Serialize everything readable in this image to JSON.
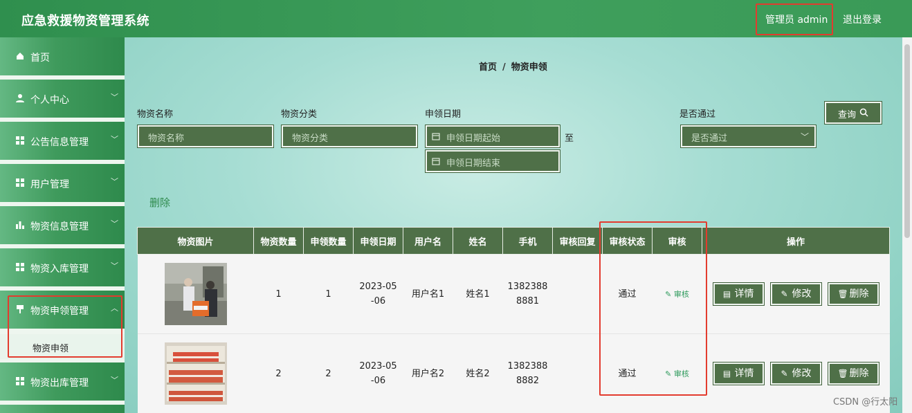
{
  "header": {
    "title": "应急救援物资管理系统",
    "admin_label": "管理员 admin",
    "logout_label": "退出登录"
  },
  "sidebar": {
    "items": [
      {
        "label": "首页",
        "icon": "home-icon"
      },
      {
        "label": "个人中心",
        "icon": "user-icon"
      },
      {
        "label": "公告信息管理",
        "icon": "grid-icon"
      },
      {
        "label": "用户管理",
        "icon": "grid-icon"
      },
      {
        "label": "物资信息管理",
        "icon": "bar-chart-icon"
      },
      {
        "label": "物资入库管理",
        "icon": "grid-icon"
      },
      {
        "label": "物资申领管理",
        "icon": "pin-icon"
      },
      {
        "label": "物资出库管理",
        "icon": "grid-icon"
      }
    ],
    "submenu_label": "物资申领"
  },
  "breadcrumb": {
    "home": "首页",
    "separator": "/",
    "current": "物资申领"
  },
  "filters": {
    "name_label": "物资名称",
    "name_placeholder": "物资名称",
    "category_label": "物资分类",
    "category_placeholder": "物资分类",
    "date_label": "申领日期",
    "date_start_placeholder": "申领日期起始",
    "date_end_placeholder": "申领日期结束",
    "to": "至",
    "pass_label": "是否通过",
    "pass_placeholder": "是否通过",
    "search_label": "查询"
  },
  "delete_label": "删除",
  "table": {
    "columns": [
      "物资图片",
      "物资数量",
      "申领数量",
      "申领日期",
      "用户名",
      "姓名",
      "手机",
      "审核回复",
      "审核状态",
      "审核",
      "操作"
    ],
    "rows": [
      {
        "qty": "1",
        "apply_qty": "1",
        "date_a": "2023-05",
        "date_b": "-06",
        "username": "用户名1",
        "name": "姓名1",
        "phone_a": "1382388",
        "phone_b": "8881",
        "reply": "",
        "status": "通过",
        "audit": "审核"
      },
      {
        "qty": "2",
        "apply_qty": "2",
        "date_a": "2023-05",
        "date_b": "-06",
        "username": "用户名2",
        "name": "姓名2",
        "phone_a": "1382388",
        "phone_b": "8882",
        "reply": "",
        "status": "通过",
        "audit": "审核"
      }
    ],
    "actions": {
      "detail": "详情",
      "edit": "修改",
      "delete": "删除"
    }
  },
  "watermark": "CSDN @行太阳",
  "colors": {
    "header": "#3a9a57",
    "button": "#4f7048",
    "highlight": "#e33b2e"
  }
}
